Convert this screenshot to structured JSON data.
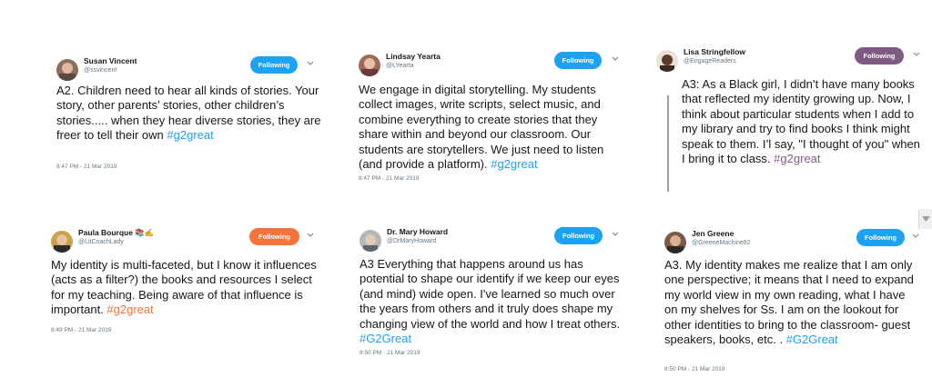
{
  "tweets": [
    {
      "name": "Susan Vincent",
      "handle": "@ssvincent",
      "follow_label": "Following",
      "text": "A2. Children need to hear all kinds of stories. Your story, other parents’ stories, other children’s stories..... when they hear diverse stories, they are freer to tell their own ",
      "hashtag": "#g2great",
      "timestamp": "8:47 PM - 21 Mar 2019",
      "button_color": "#1da1f2",
      "hashtag_color": "#1da1f2"
    },
    {
      "name": "Lindsay Yearta",
      "handle": "@LYearta",
      "follow_label": "Following",
      "text": "We engage in digital storytelling. My students collect images, write scripts, select music, and combine everything to create stories that they share within and beyond our classroom. Our students are storytellers. We just need to listen (and provide a platform). ",
      "hashtag": "#g2great",
      "timestamp": "8:47 PM - 21 Mar 2019",
      "button_color": "#1da1f2",
      "hashtag_color": "#1da1f2"
    },
    {
      "name": "Lisa Stringfellow",
      "handle": "@EngageReaders",
      "follow_label": "Following",
      "text": "A3: As a Black girl, I didn’t have many books that reflected my identity growing up. Now, I think about particular students when I add to my library and try to find books I think might speak to them. I’l say, \"I thought of you\" when I bring it to class. ",
      "hashtag": "#g2great",
      "timestamp": "",
      "button_color": "#7f5a83",
      "hashtag_color": "#7f5a83"
    },
    {
      "name": "Paula Bourque 📚✍️",
      "handle": "@LitCoachLady",
      "follow_label": "Following",
      "text": "My identity is multi-faceted, but I know it influences (acts as a filter?) the books and resources I select for my teaching. Being aware of that influence is important. ",
      "hashtag": "#g2great",
      "timestamp": "8:49 PM - 21 Mar 2019",
      "button_color": "#f4743b",
      "hashtag_color": "#f4743b"
    },
    {
      "name": "Dr. Mary Howard",
      "handle": "@DrMaryHoward",
      "follow_label": "Following",
      "text": "A3 Everything that happens around us has potential to shape our identify if we keep our eyes (and mind) wide open. I've learned so much over the years from others and it truly does shape my changing view of the world and how I treat others. ",
      "hashtag": "#G2Great",
      "timestamp": "8:50 PM - 21 Mar 2019",
      "button_color": "#1da1f2",
      "hashtag_color": "#1da1f2"
    },
    {
      "name": "Jen Greene",
      "handle": "@GreeneMachine82",
      "follow_label": "Following",
      "text": "A3. My identity makes me realize that I am only one perspective; it means that I need to expand my world view in my own reading, what I have on my shelves for Ss. I am on the lookout for other identities to bring to the classroom- guest speakers, books, etc. . ",
      "hashtag": "#G2Great",
      "timestamp": "8:50 PM - 21 Mar 2019",
      "button_color": "#1da1f2",
      "hashtag_color": "#1da1f2"
    }
  ]
}
